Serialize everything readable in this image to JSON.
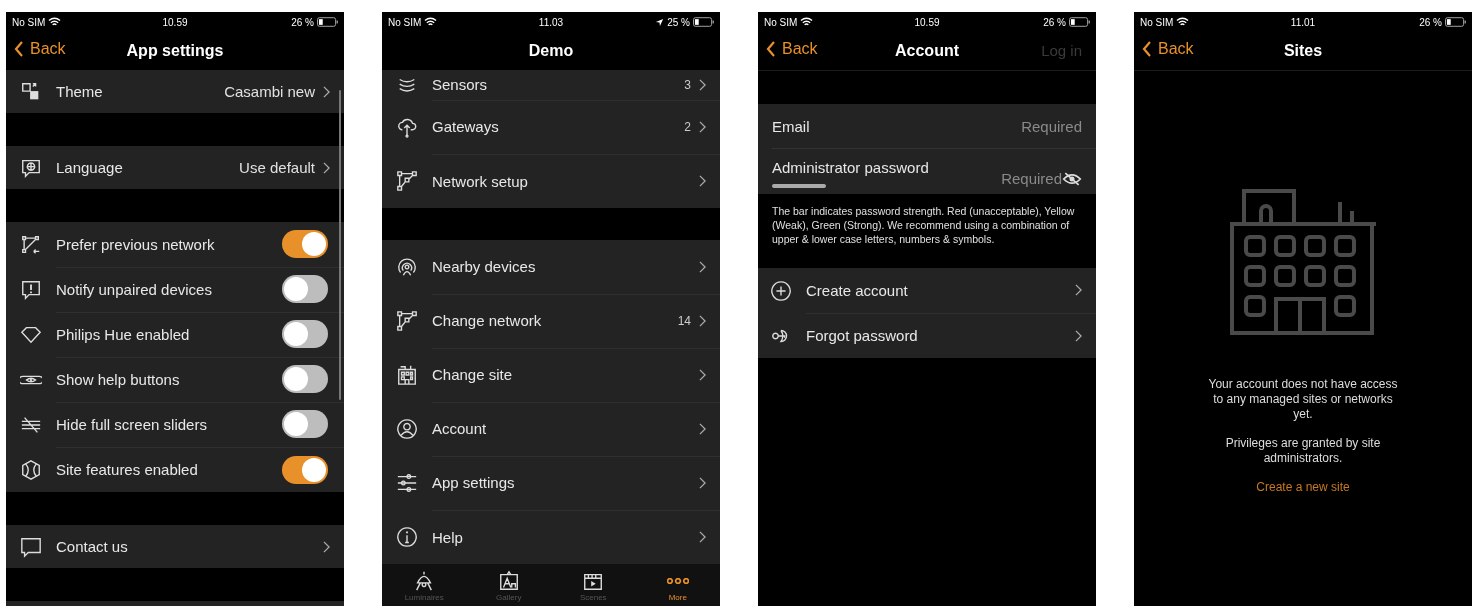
{
  "screens": [
    {
      "kind": "settings",
      "status": {
        "carrier": "No SIM",
        "time": "10.59",
        "battery": "26 %"
      },
      "back": "Back",
      "title": "App settings",
      "sections": [
        {
          "rows": [
            {
              "kind": "link",
              "label": "Theme",
              "value": "Casambi new"
            }
          ]
        },
        {
          "rows": [
            {
              "kind": "link",
              "label": "Language",
              "value": "Use default"
            }
          ]
        },
        {
          "rows": [
            {
              "kind": "toggle",
              "label": "Prefer previous network",
              "on": true
            },
            {
              "kind": "toggle",
              "label": "Notify unpaired devices",
              "on": false
            },
            {
              "kind": "toggle",
              "label": "Philips Hue enabled",
              "on": false
            },
            {
              "kind": "toggle",
              "label": "Show help buttons",
              "on": false
            },
            {
              "kind": "toggle",
              "label": "Hide full screen sliders",
              "on": false
            },
            {
              "kind": "toggle",
              "label": "Site features enabled",
              "on": true
            }
          ]
        },
        {
          "rows": [
            {
              "kind": "link",
              "label": "Contact us"
            }
          ]
        }
      ]
    },
    {
      "kind": "menu",
      "status": {
        "carrier": "No SIM",
        "time": "11.03",
        "battery": "25 %",
        "location": true
      },
      "title": "Demo",
      "sections": [
        {
          "rows": [
            {
              "label": "Sensors",
              "count": "3"
            },
            {
              "label": "Gateways",
              "count": "2"
            },
            {
              "label": "Network setup"
            }
          ]
        },
        {
          "rows": [
            {
              "label": "Nearby devices"
            },
            {
              "label": "Change network",
              "count": "14"
            },
            {
              "label": "Change site"
            },
            {
              "label": "Account"
            },
            {
              "label": "App settings"
            },
            {
              "label": "Help"
            }
          ]
        }
      ],
      "tabs": [
        {
          "label": "Luminaires",
          "selected": false
        },
        {
          "label": "Gallery",
          "selected": false
        },
        {
          "label": "Scenes",
          "selected": false
        },
        {
          "label": "More",
          "selected": true
        }
      ]
    },
    {
      "kind": "form",
      "status": {
        "carrier": "No SIM",
        "time": "10.59",
        "battery": "26 %"
      },
      "back": "Back",
      "title": "Account",
      "action": {
        "label": "Log in",
        "disabled": true
      },
      "fields": [
        {
          "label": "Email",
          "placeholder": "Required"
        },
        {
          "label": "Administrator password",
          "placeholder": "Required",
          "kind": "password"
        }
      ],
      "note": "The bar indicates password strength. Red (unacceptable), Yellow (Weak), Green (Strong). We recommend using a combination of upper & lower case letters, numbers & symbols.",
      "rows": [
        {
          "label": "Create account"
        },
        {
          "label": "Forgot password"
        }
      ]
    },
    {
      "kind": "empty",
      "status": {
        "carrier": "No SIM",
        "time": "11.01",
        "battery": "26 %"
      },
      "back": "Back",
      "title": "Sites",
      "messages": [
        "Your account does not have access to any managed sites or networks yet.",
        "Privileges are granted by site administrators."
      ],
      "link": "Create a new site"
    }
  ]
}
